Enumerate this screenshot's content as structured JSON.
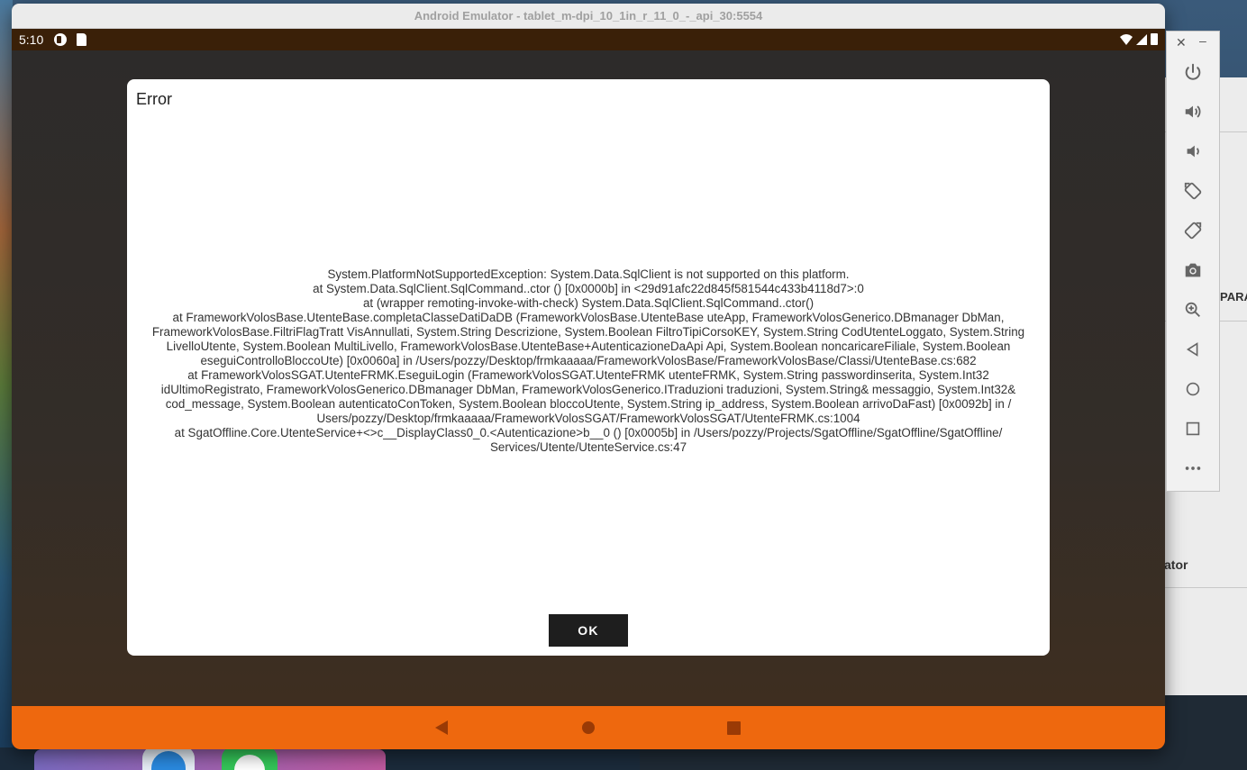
{
  "window": {
    "title": "Android Emulator - tablet_m-dpi_10_1in_r_11_0_-_api_30:5554"
  },
  "statusbar": {
    "time": "5:10"
  },
  "dialog": {
    "title": "Error",
    "message_lines": [
      "System.PlatformNotSupportedException: System.Data.SqlClient is not supported on this platform.",
      "at System.Data.SqlClient.SqlCommand..ctor () [0x0000b] in <29d91afc22d845f581544c433b4118d7>:0",
      "at (wrapper remoting-invoke-with-check) System.Data.SqlClient.SqlCommand..ctor()",
      "at FrameworkVolosBase.UtenteBase.completaClasseDatiDaDB (FrameworkVolosBase.UtenteBase uteApp, FrameworkVolosGenerico.DBmanager DbMan,",
      "FrameworkVolosBase.FiltriFlagTratt VisAnnullati, System.String Descrizione, System.Boolean FiltroTipiCorsoKEY, System.String CodUtenteLoggato, System.String",
      "LivelloUtente, System.Boolean MultiLivello, FrameworkVolosBase.UtenteBase+AutenticazioneDaApi Api, System.Boolean noncaricareFiliale, System.Boolean",
      "eseguiControlloBloccoUte) [0x0060a] in /Users/pozzy/Desktop/frmkaaaaa/FrameworkVolosBase/FrameworkVolosBase/Classi/UtenteBase.cs:682",
      "at FrameworkVolosSGAT.UtenteFRMK.EseguiLogin (FrameworkVolosSGAT.UtenteFRMK utenteFRMK, System.String passwordinserita, System.Int32",
      "idUltimoRegistrato, FrameworkVolosGenerico.DBmanager DbMan, FrameworkVolosGenerico.ITraduzioni traduzioni, System.String& messaggio, System.Int32&",
      "cod_message, System.Boolean autenticatoConToken, System.Boolean bloccoUtente, System.String ip_address, System.Boolean arrivoDaFast) [0x0092b] in /",
      "Users/pozzy/Desktop/frmkaaaaa/FrameworkVolosSGAT/FrameworkVolosSGAT/UtenteFRMK.cs:1004",
      "at SgatOffline.Core.UtenteService+<>c__DisplayClass0_0.<Autenticazione>b__0 () [0x0005b] in /Users/pozzy/Projects/SgatOffline/SgatOffline/SgatOffline/",
      "Services/Utente/UtenteService.cs:47"
    ],
    "ok_label": "OK"
  },
  "side_toolbar": {
    "close_label": "✕",
    "minimize_label": "–",
    "buttons": [
      "power-icon",
      "volume-up-icon",
      "volume-down-icon",
      "rotate-left-icon",
      "rotate-right-icon",
      "camera-icon",
      "zoom-icon",
      "back-icon",
      "home-icon",
      "overview-icon",
      "more-icon"
    ]
  },
  "background_app": {
    "text_1": "PARA",
    "text_2": "ator"
  },
  "colors": {
    "navbar": "#ee680e",
    "statusbar": "#3a2008",
    "ok_button": "#1e1e1e"
  }
}
